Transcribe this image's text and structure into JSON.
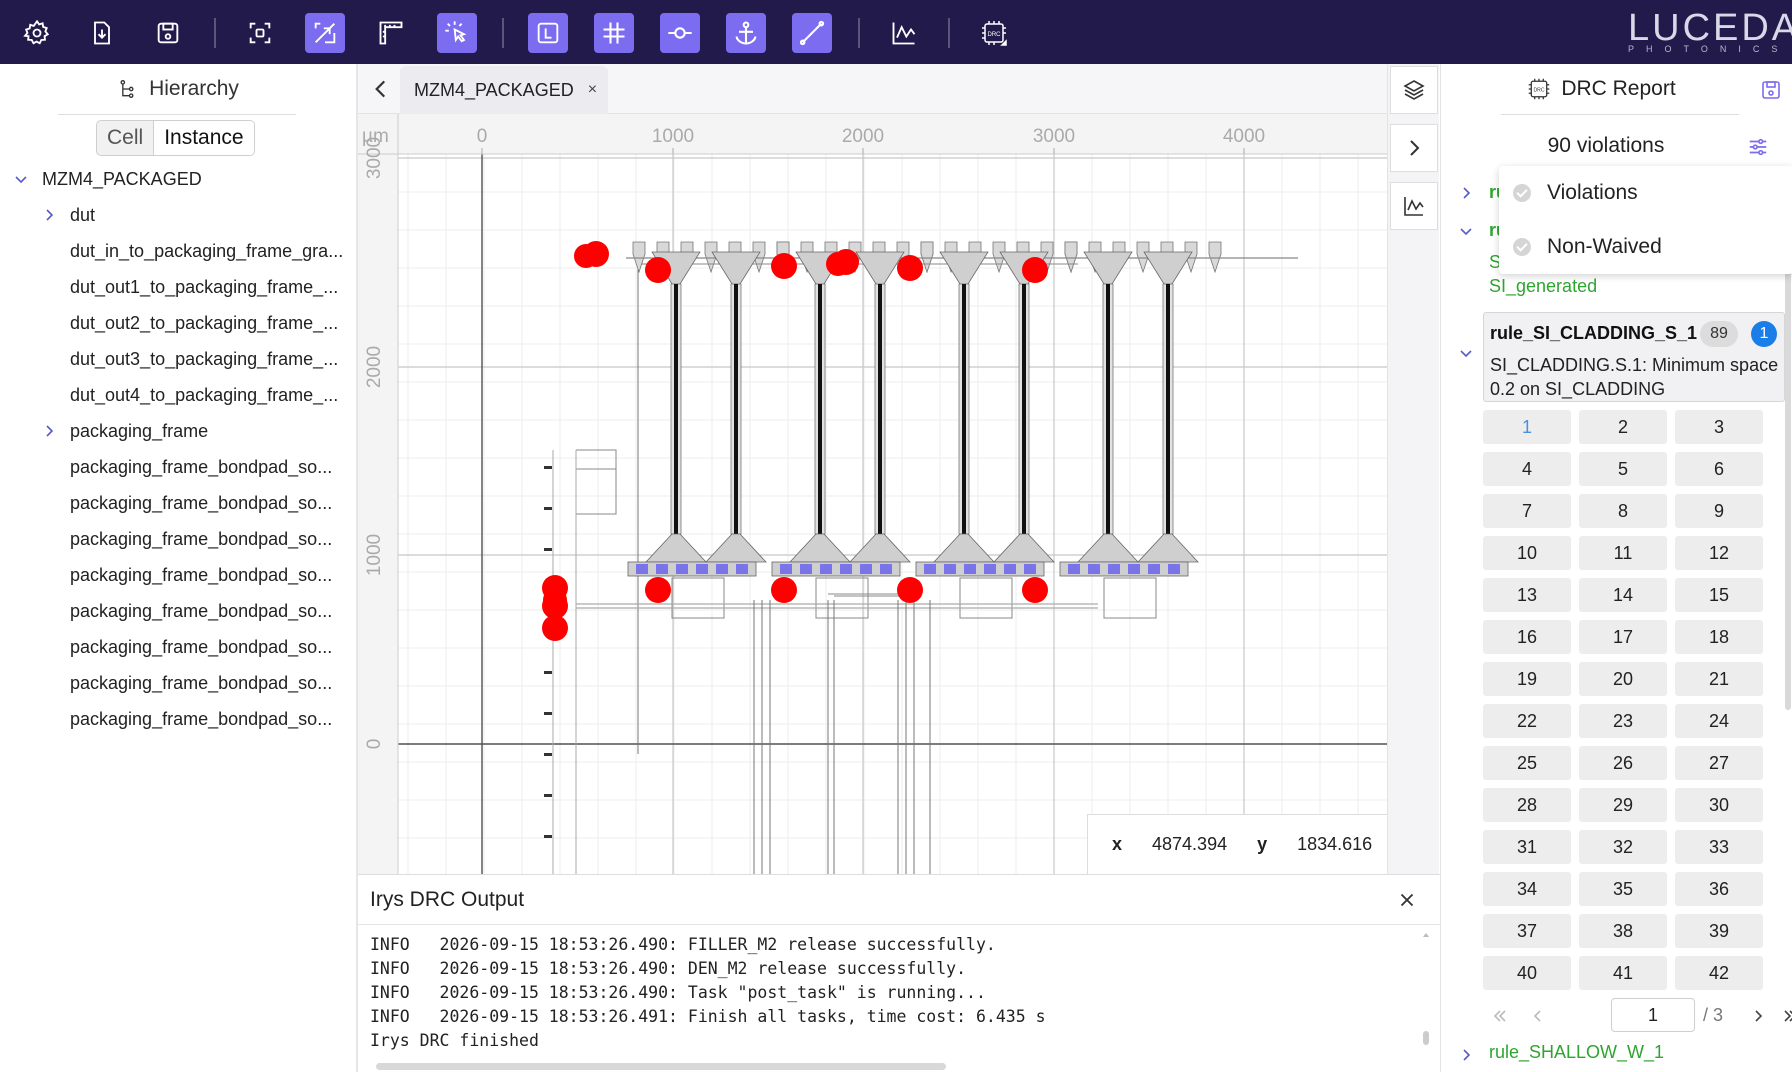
{
  "toolbar": {
    "logo_main": "LUCEDA",
    "logo_sub": "PHOTONICS",
    "drc_label": "DRC"
  },
  "hierarchy": {
    "title": "Hierarchy",
    "toggle": [
      "Cell",
      "Instance"
    ],
    "items": [
      "MZM4_PACKAGED",
      "dut",
      "dut_in_to_packaging_frame_gra...",
      "dut_out1_to_packaging_frame_...",
      "dut_out2_to_packaging_frame_...",
      "dut_out3_to_packaging_frame_...",
      "dut_out4_to_packaging_frame_...",
      "packaging_frame",
      "packaging_frame_bondpad_so...",
      "packaging_frame_bondpad_so...",
      "packaging_frame_bondpad_so...",
      "packaging_frame_bondpad_so...",
      "packaging_frame_bondpad_so...",
      "packaging_frame_bondpad_so...",
      "packaging_frame_bondpad_so...",
      "packaging_frame_bondpad_so..."
    ]
  },
  "tab": {
    "label": "MZM4_PACKAGED",
    "close": "×"
  },
  "viewport": {
    "unit": "µm",
    "x_ticks": [
      "0",
      "1000",
      "2000",
      "3000",
      "4000"
    ],
    "y_ticks": [
      "3000",
      "2000",
      "1000",
      "0"
    ],
    "x_label": "x",
    "x_value": "4874.394",
    "y_label": "y",
    "y_value": "1834.616"
  },
  "drc_output": {
    "title": "Irys DRC Output",
    "lines": [
      "INFO   2026-09-15 18:53:26.490: FILLER_M2 release successfully.",
      "INFO   2026-09-15 18:53:26.490: DEN_M2 release successfully.",
      "INFO   2026-09-15 18:53:26.490: Task \"post_task\" is running...",
      "INFO   2026-09-15 18:53:26.491: Finish all tasks, time cost: 6.435 s",
      "Irys DRC finished"
    ]
  },
  "drc_report": {
    "title": "DRC Report",
    "count": "90 violations",
    "filter": [
      "Violations",
      "Non-Waived"
    ],
    "rule_stub1": "ru",
    "rule_stub2": "ru",
    "rule_stub2_sub": "S",
    "rule_stub2_sub2": "SI_generated",
    "selected_rule": {
      "name": "rule_SI_CLADDING_S_1",
      "count": "89",
      "index": "1",
      "desc": "SI_CLADDING.S.1: Minimum space 0.2 on SI_CLADDING"
    },
    "cells": [
      "1",
      "2",
      "3",
      "4",
      "5",
      "6",
      "7",
      "8",
      "9",
      "10",
      "11",
      "12",
      "13",
      "14",
      "15",
      "16",
      "17",
      "18",
      "19",
      "20",
      "21",
      "22",
      "23",
      "24",
      "25",
      "26",
      "27",
      "28",
      "29",
      "30",
      "31",
      "32",
      "33",
      "34",
      "35",
      "36",
      "37",
      "38",
      "39",
      "40",
      "41",
      "42"
    ],
    "page": "1",
    "page_total": "/ 3",
    "next_rule": "rule_SHALLOW_W_1"
  },
  "colors": {
    "toolbar_bg": "#221a4a",
    "active_tool": "#7b6cf0",
    "violation": "#ff0000",
    "rule_green": "#2ea52e",
    "badge_blue": "#1a7de8"
  }
}
